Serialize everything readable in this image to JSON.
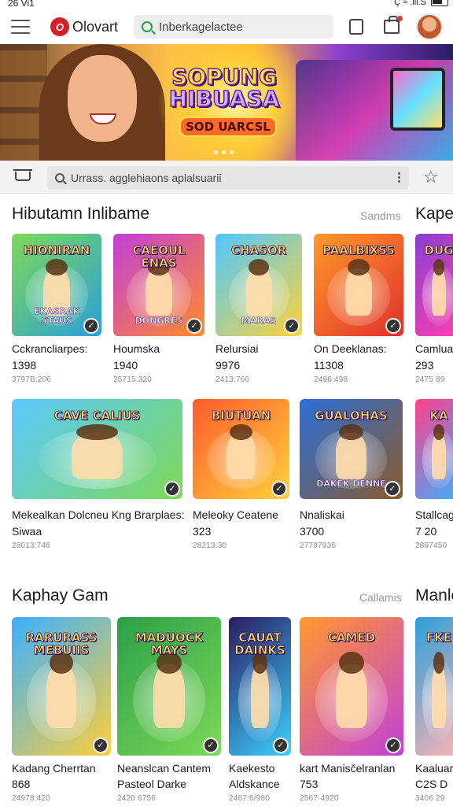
{
  "status": {
    "time": "26 Vi1",
    "signal": "Ç ≈ .ill.S"
  },
  "top_bar": {
    "logo_mark": "O",
    "logo_text": "Olovart",
    "search_value": "Inberkagelactee"
  },
  "banner": {
    "title_line1": "SOPUNG",
    "title_line2": "HIBUASA",
    "subtitle": "SOD UARCSL"
  },
  "sub_bar": {
    "search_value": "Urrass. agglehiaons aplalsuarii"
  },
  "sections": [
    {
      "title": "Hibutamn Inlibame",
      "more": "Sandms",
      "peek_title": "Kaper",
      "cards": [
        {
          "thumb_title": "HIONIRAN",
          "thumb_sub": "EKASRAK STAUS",
          "name": "Cckrancliarpes:",
          "line2": "1398",
          "meta": "3797B:206",
          "colors": [
            "#7ed957",
            "#2b9fd9"
          ]
        },
        {
          "thumb_title": "CAEOUL ENAS",
          "thumb_sub": "DONGRES",
          "name": "Houmska",
          "line2": "1940",
          "meta": "25715:320",
          "colors": [
            "#c23fd9",
            "#ff8c2b"
          ]
        },
        {
          "thumb_title": "CHASOR",
          "thumb_sub": "MARAS",
          "name": "Relursiai",
          "line2": "9976",
          "meta": "2413:766",
          "colors": [
            "#4fc8ff",
            "#ffd23b"
          ]
        },
        {
          "thumb_title": "PAALBIXSS",
          "thumb_sub": "",
          "name": "On Deeklanas:",
          "line2": "11308",
          "meta": "2496:498",
          "colors": [
            "#ff9a2b",
            "#e0302b"
          ]
        },
        {
          "thumb_title": "DUG",
          "thumb_sub": "",
          "name": "Camluar",
          "line2": "293",
          "meta": "2475 89",
          "colors": [
            "#8a3fd1",
            "#ff3fb0"
          ]
        }
      ]
    },
    {
      "title": "",
      "more": "",
      "peek_title": "",
      "cards": [
        {
          "thumb_title": "CAVE CALIUS",
          "thumb_sub": "",
          "name": "Mekealkan Dolcneu Kng Brarplaes:",
          "line2": "Siwaa",
          "meta": "28013:746",
          "colors": [
            "#5ac8ff",
            "#7ed957"
          ]
        },
        {
          "thumb_title": "BIUTUAN",
          "thumb_sub": "",
          "name": "Meleoky Ceatene",
          "line2": "323",
          "meta": "28213:30",
          "colors": [
            "#ff5a2b",
            "#ffd23b"
          ]
        },
        {
          "thumb_title": "GUALOHAS",
          "thumb_sub": "DAKEK DENNE",
          "name": "Nnaliskai",
          "line2": "3700",
          "meta": "27797936",
          "colors": [
            "#2b6fd9",
            "#8a5a2b"
          ]
        },
        {
          "thumb_title": "KA",
          "thumb_sub": "",
          "name": "Stallcag",
          "line2": "7 20",
          "meta": "2897450",
          "colors": [
            "#ff3f8c",
            "#3bb0ff"
          ]
        }
      ]
    },
    {
      "title": "Kaphay Gam",
      "more": "Callamis",
      "peek_title": "Manlo",
      "cards": [
        {
          "thumb_title": "RARURASS MEBUIIS",
          "thumb_sub": "",
          "name": "Kadang Cherrtan",
          "line2": "868",
          "meta": "24978.420",
          "colors": [
            "#3bb0ff",
            "#ffcf3b"
          ]
        },
        {
          "thumb_title": "MADUOCK MAYS",
          "thumb_sub": "",
          "name": "Neanslcan Cantem",
          "line2": "Pasteol Darke",
          "meta": "2420 6756",
          "colors": [
            "#2b9f49",
            "#7ed957"
          ]
        },
        {
          "thumb_title": "CAUAT DAINKS",
          "thumb_sub": "",
          "name": "Kaekesto",
          "line2": "Aldskance",
          "meta": "2467:6/980",
          "colors": [
            "#2a1d62",
            "#3bd0ff"
          ]
        },
        {
          "thumb_title": "CAMED",
          "thumb_sub": "",
          "name": "kart Manisčelranlan",
          "line2": "753",
          "meta": "2567·4920",
          "colors": [
            "#ff9a2b",
            "#c23fd9"
          ]
        },
        {
          "thumb_title": "FKE",
          "thumb_sub": "",
          "name": "Kaaluar",
          "line2": "C2S D",
          "meta": "3406 29",
          "colors": [
            "#2b9fd9",
            "#ffb3b3"
          ]
        }
      ]
    }
  ]
}
